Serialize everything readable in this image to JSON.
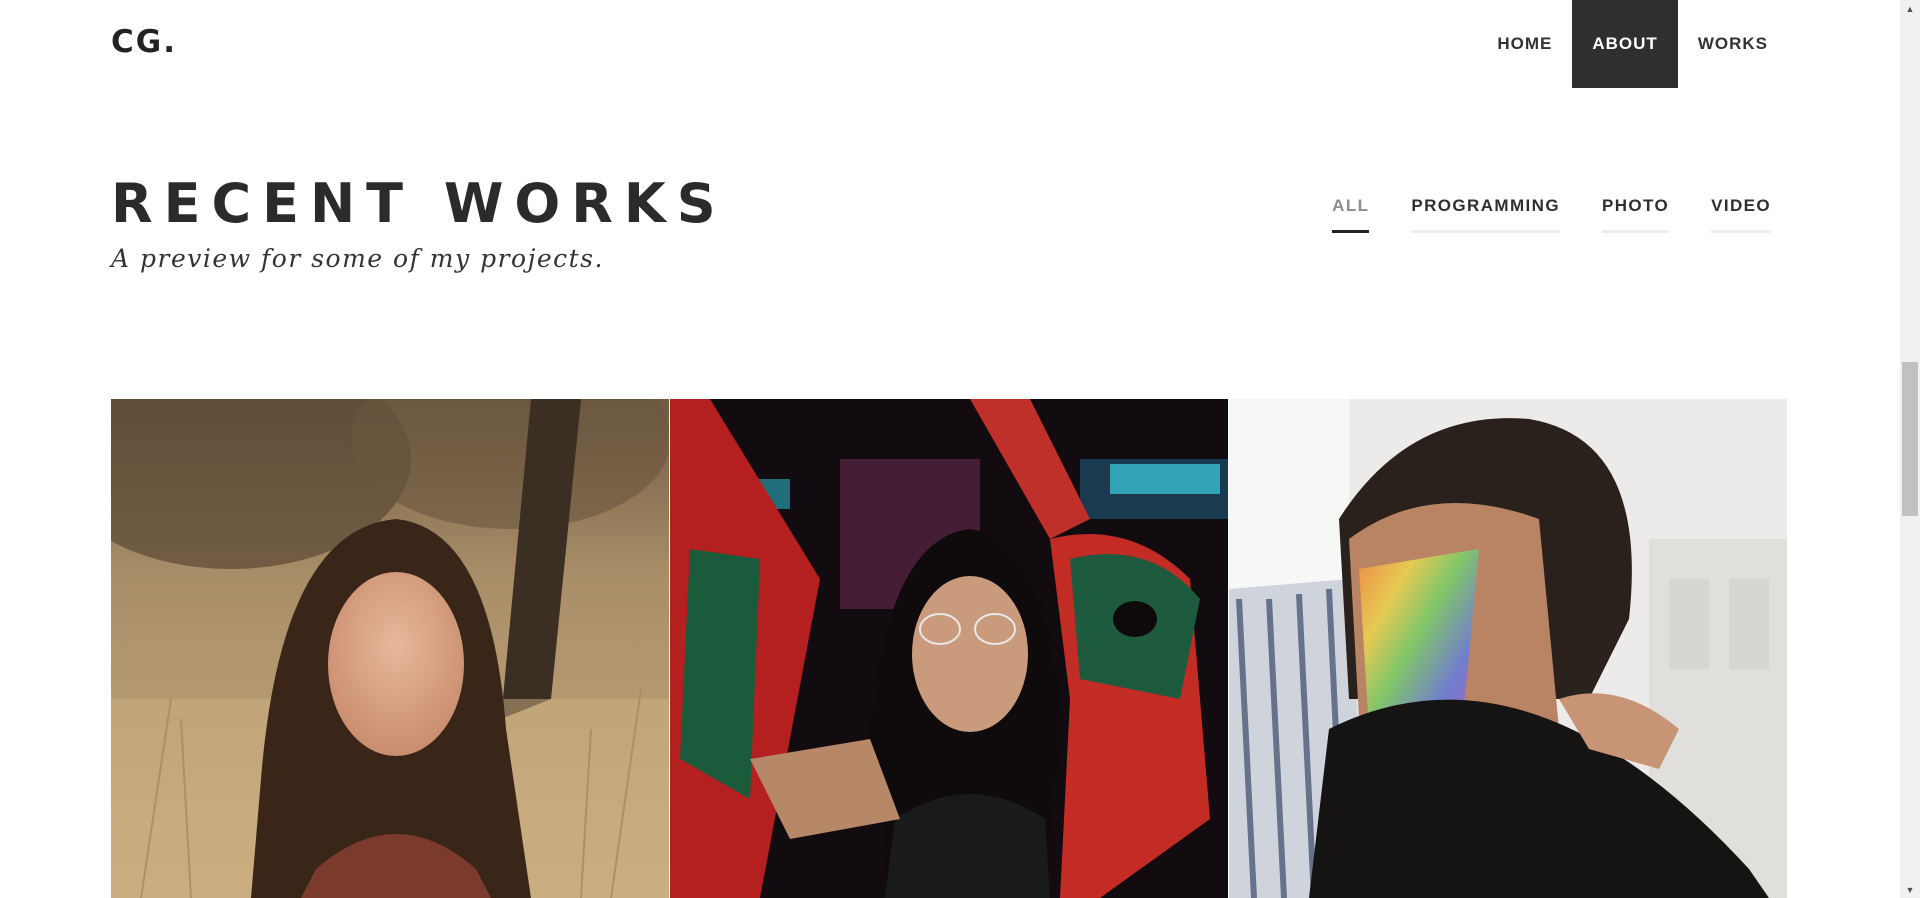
{
  "header": {
    "logo": "CG.",
    "nav": [
      {
        "label": "HOME",
        "active": false
      },
      {
        "label": "ABOUT",
        "active": true
      },
      {
        "label": "WORKS",
        "active": false
      }
    ]
  },
  "section": {
    "title": "RECENT WORKS",
    "subtitle": "A preview for some of my projects."
  },
  "filters": [
    {
      "label": "ALL",
      "active": true
    },
    {
      "label": "PROGRAMMING",
      "active": false
    },
    {
      "label": "PHOTO",
      "active": false
    },
    {
      "label": "VIDEO",
      "active": false
    }
  ],
  "gallery": [
    {
      "theme": "portrait-field",
      "colors": {
        "bg": "#b89a6e",
        "accent": "#3a2a1d"
      }
    },
    {
      "theme": "portrait-arcade",
      "colors": {
        "bg": "#1a0f14",
        "accent": "#c72c2c"
      }
    },
    {
      "theme": "portrait-rainbow",
      "colors": {
        "bg": "#e9e7e4",
        "accent": "#2a2624"
      }
    }
  ],
  "scrollbar": {
    "up_icon": "arrow-up-icon",
    "down_icon": "arrow-down-icon"
  }
}
